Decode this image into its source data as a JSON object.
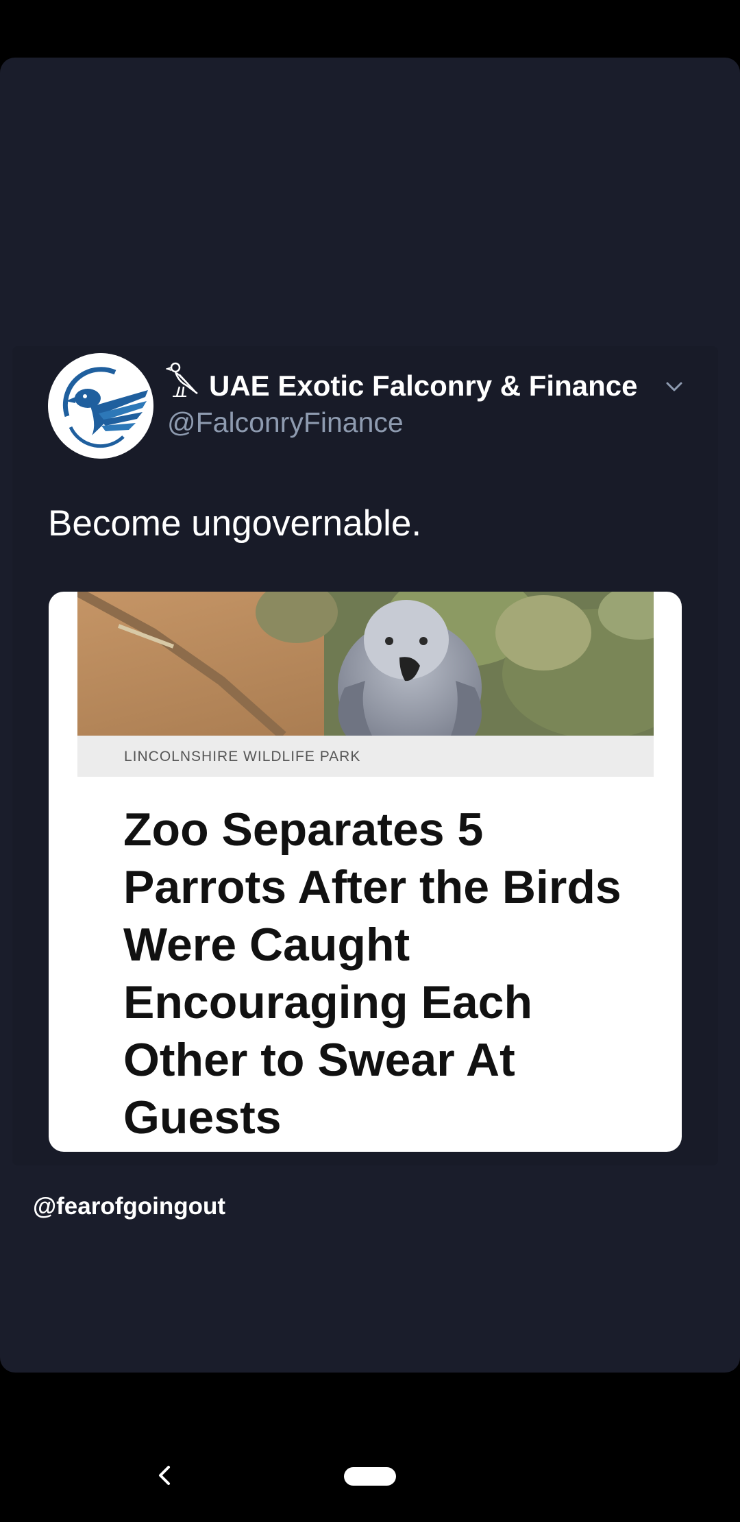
{
  "tweet": {
    "display_name": "UAE Exotic Falconry & Finance",
    "handle": "@FalconryFinance",
    "text": "Become ungovernable.",
    "name_icon": "falcon-hieroglyph-icon",
    "menu_icon": "chevron-down-icon",
    "avatar_icon": "falcon-logo-icon"
  },
  "article": {
    "source": "LINCOLNSHIRE WILDLIFE PARK",
    "headline": "Zoo Separates 5 Parrots After the Birds Were Caught Encouraging Each Other to Swear At Guests",
    "image_subject": "african-grey-parrot"
  },
  "credit": "@fearofgoingout",
  "navigation": {
    "back_icon": "chevron-left-icon",
    "home_icon": "home-pill"
  },
  "colors": {
    "panel_background": "#1a1d2b",
    "card_background": "#181b28",
    "handle_text": "#8e9bb0",
    "logo_blue": "#1f5f9e"
  }
}
